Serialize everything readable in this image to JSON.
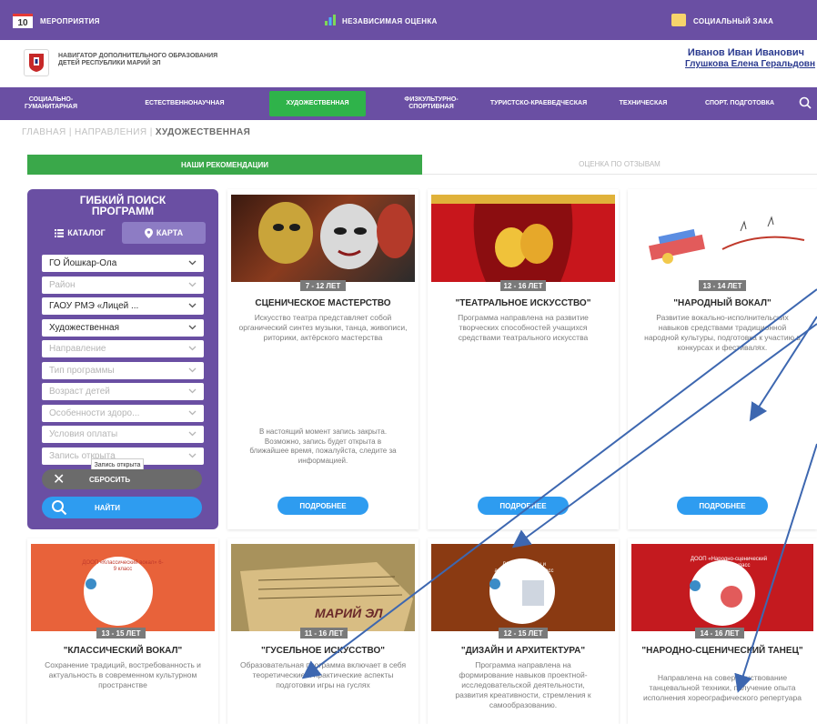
{
  "topbar": {
    "calendar_day": "10",
    "events": "Мероприятия",
    "independent": "Независимая оценка",
    "social": "Социальный зака"
  },
  "header": {
    "logo_title": "Навигатор дополнительного образования детей Республики Марий Эл",
    "user_name": "Иванов Иван Иванович",
    "user_sub": "Глушкова Елена Геральдовн"
  },
  "nav": {
    "items": [
      "Социально-гуманитарная",
      "Естественнонаучная",
      "Художественная",
      "Физкультурно-спортивная",
      "Туристско-краеведческая",
      "Техническая",
      "Спорт. подготовка"
    ],
    "active": "Художественная"
  },
  "breadcrumb": {
    "home": "Главная",
    "sep1": "|",
    "directions": "Направления",
    "sep2": "|",
    "current": "Художественная"
  },
  "tabs": {
    "recommendations": "Наши рекомендации",
    "reviews": "Оценка по отзывам"
  },
  "filter": {
    "title": "Гибкий поиск программ",
    "catalog": "Каталог",
    "map": "Карта",
    "fields": [
      {
        "value": "ГО Йошкар-Ола",
        "placeholder": false
      },
      {
        "value": "Район",
        "placeholder": true
      },
      {
        "value": "ГАОУ РМЭ «Лицей ...",
        "placeholder": false
      },
      {
        "value": "Художественная",
        "placeholder": false
      },
      {
        "value": "Направление",
        "placeholder": true
      },
      {
        "value": "Тип программы",
        "placeholder": true
      },
      {
        "value": "Возраст детей",
        "placeholder": true
      },
      {
        "value": "Особенности здоро...",
        "placeholder": true
      },
      {
        "value": "Условия оплаты",
        "placeholder": true
      },
      {
        "value": "Запись открыта",
        "placeholder": true
      }
    ],
    "tooltip": "Запись открыта",
    "reset": "Сбросить",
    "find": "Найти"
  },
  "cards": [
    {
      "age": "7 - 12 лет",
      "title": "Сценическое мастерство",
      "desc": "Искусство театра представляет собой органический синтез музыки, танца, живописи, риторики, актёрского мастерства",
      "note": "В настоящий момент запись закрыта. Возможно, запись будет открыта в ближайшее время, пожалуйста, следите за информацией.",
      "button": "Подробнее"
    },
    {
      "age": "12 - 16 лет",
      "title": "\"Театральное искусство\"",
      "desc": "Программа направлена на развитие творческих способностей учащихся средствами театрального искусства",
      "note": "",
      "button": "Подробнее"
    },
    {
      "age": "13 - 14 лет",
      "title": "\"Народный вокал\"",
      "desc": "Развитие вокально-исполнительских навыков средствами традиционной народной культуры, подготовка к участию в конкурсах и фестивалях.",
      "note": "",
      "button": "Подробнее"
    },
    {
      "age": "13 - 15 лет",
      "title": "\"Классический вокал\"",
      "desc": "Сохранение традиций, востребованность и актуальность в современном культурном пространстве",
      "image_text": "ДООП «Классический вокал» 6-9 класс",
      "button": ""
    },
    {
      "age": "11 - 16 лет",
      "title": "\"Гусельное искусство\"",
      "desc": "Образовательная программа включает в себя теоретические и практические аспекты подготовки игры на гуслях",
      "image_text": "МАРИЙ ЭЛ",
      "button": ""
    },
    {
      "age": "12 - 15 лет",
      "title": "\"Дизайн и архитектура\"",
      "desc": "Программа направлена на формирование навыков проектной-исследовательской деятельности, развития креативности, стремления к самообразованию.",
      "image_text": "ДООП «Дизайн и архитектура» 6-9 класс",
      "button": ""
    },
    {
      "age": "14 - 16 лет",
      "title": "\"Народно-сценический танец\"",
      "desc": "Направлена на совершенствование танцевальной техники, получение опыта исполнения хореографического репертуара",
      "image_text": "ДООП «Народно-сценический танец» 6-9 класс",
      "button": ""
    }
  ],
  "colors": {
    "purple": "#6a4fa3",
    "green": "#2fb34a",
    "blue_button": "#2e9cf0",
    "arrow": "#3d67b0"
  }
}
